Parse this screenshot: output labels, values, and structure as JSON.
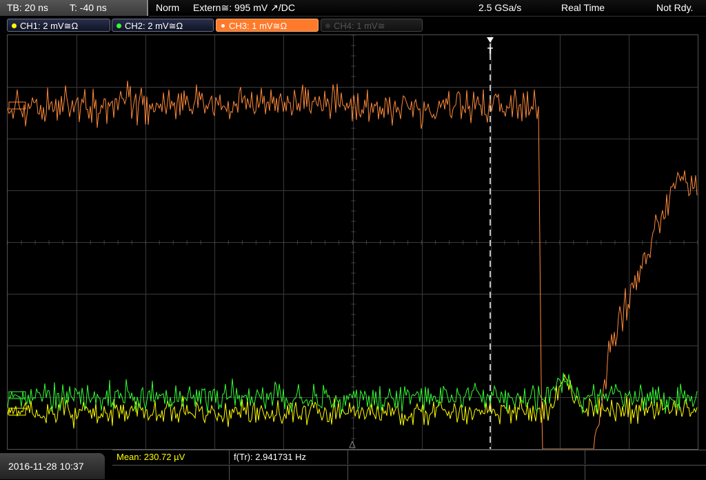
{
  "timebase": {
    "tb": "TB: 20 ns",
    "t": "T: -40 ns"
  },
  "status": {
    "mode": "Norm",
    "trigger": "Extern≅: 995 mV ↗/DC",
    "sample_rate": "2.5 GSa/s",
    "acq": "Real Time",
    "ready": "Not Rdy."
  },
  "channels": [
    {
      "label": "CH1: 2 mV≅Ω",
      "color": "#ffff00"
    },
    {
      "label": "CH2: 2 mV≅Ω",
      "color": "#33ff33"
    },
    {
      "label": "CH3: 1 mV≅Ω",
      "color": "#ff8a3a"
    },
    {
      "label": "CH4: 1 mV≅",
      "color": "#555555"
    }
  ],
  "trigger_marker": "T",
  "datetime": "2016-11-28 10:37",
  "measurements": [
    {
      "text": "Mean: 230.72 µV",
      "color": "#ffff00"
    },
    {
      "text": "f(Tr): 2.941731 Hz",
      "color": "#ffffff"
    }
  ],
  "colors": {
    "ch1": "#ffff00",
    "ch2": "#33ff33",
    "ch3": "#ff8a3a",
    "grid": "#3a3a3a"
  }
}
